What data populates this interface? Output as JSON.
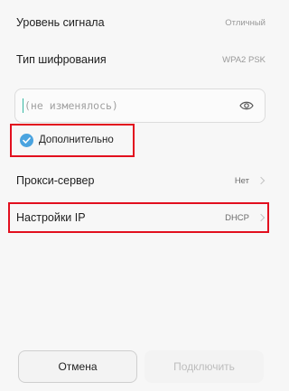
{
  "rows": [
    {
      "label": "Уровень сигнала",
      "value": "Отличный"
    },
    {
      "label": "Тип шифрования",
      "value": "WPA2 PSK"
    },
    {
      "label": "Прокси-сервер",
      "value": "Нет"
    },
    {
      "label": "Настройки IP",
      "value": "DHCP"
    }
  ],
  "password": {
    "placeholder": "(не изменялось)",
    "toggle_icon": "eye-icon"
  },
  "advanced": {
    "label": "Дополнительно",
    "checked": true,
    "check_color": "#4aa3df"
  },
  "buttons": {
    "cancel": "Отмена",
    "connect": "Подключить"
  },
  "highlight_color": "#e20f1e"
}
